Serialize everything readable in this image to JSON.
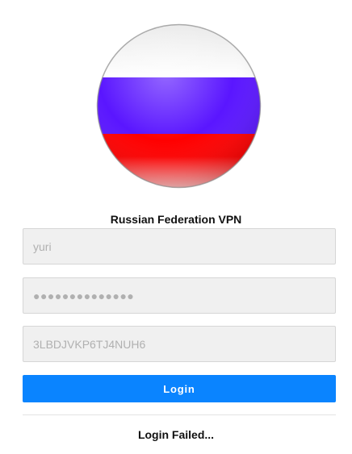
{
  "app": {
    "title": "Russian Federation VPN"
  },
  "logo": {
    "icon": "russian-flag-sphere-icon",
    "stripe_colors": [
      "#ffffff",
      "#5a16ff",
      "#ff0000"
    ]
  },
  "form": {
    "username": {
      "value": "yuri"
    },
    "password": {
      "value": "●●●●●●●●●●●●●●"
    },
    "key": {
      "value": "3LBDJVKP6TJ4NUH6"
    },
    "login_label": "Login"
  },
  "status": {
    "message": "Login Failed..."
  },
  "colors": {
    "accent": "#0a84ff"
  }
}
